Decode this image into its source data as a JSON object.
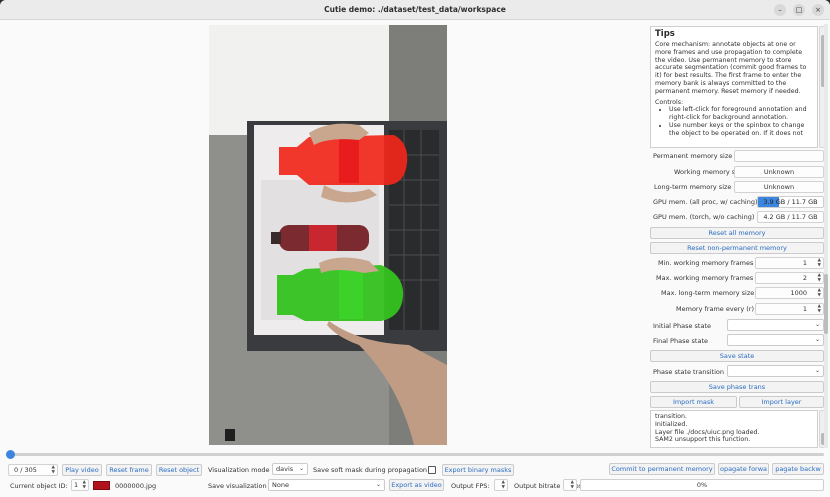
{
  "window": {
    "title": "Cutie demo: ./dataset/test_data/workspace",
    "minimize": "–",
    "maximize": "□",
    "close": "×"
  },
  "tips": {
    "heading": "Tips",
    "paragraph": "Core mechanism: annotate objects at one or more frames and use propagation to complete the video. Use permanent memory to store accurate segmentation (commit good frames to it) for best results. The first frame to enter the memory bank is always committed to the permanent memory. Reset memory if needed.",
    "controls_label": "Controls:",
    "controls": [
      "Use left-click for foreground annotation and right-click for background annotation.",
      "Use number keys or the spinbox to change the object to be operated on. If it does not"
    ]
  },
  "memory": {
    "permanent_label": "Permanent memory size",
    "permanent_value": "",
    "working_label": "Working memory size",
    "working_value": "Unknown",
    "longterm_label": "Long-term memory size",
    "longterm_value": "Unknown",
    "gpu_all_label": "GPU mem. (all proc, w/ caching)",
    "gpu_all_value": "3.9 GB / 11.7 GB",
    "gpu_all_fraction": 0.33,
    "gpu_torch_label": "GPU mem. (torch, w/o caching)",
    "gpu_torch_value": "4.2 GB / 11.7 GB",
    "reset_all": "Reset all memory",
    "reset_nonperm": "Reset non-permanent memory",
    "min_working_label": "Min. working memory frames",
    "min_working_value": "1",
    "max_working_label": "Max. working memory frames",
    "max_working_value": "2",
    "max_longterm_label": "Max. long-term memory size",
    "max_longterm_value": "1000",
    "mem_every_label": "Memory frame every (r)",
    "mem_every_value": "1"
  },
  "phase": {
    "initial_label": "Initial Phase state",
    "initial_value": "",
    "final_label": "Final Phase state",
    "final_value": "",
    "save_state": "Save state",
    "transition_label": "Phase state transition",
    "transition_value": "",
    "save_trans": "Save phase trans",
    "import_mask": "Import mask",
    "import_layer": "Import layer"
  },
  "log": [
    "transition.",
    "Initialized.",
    "Layer file ./docs/uiuc.png loaded.",
    "SAM2 unsupport this function."
  ],
  "bottom": {
    "frame_counter": "0 / 305",
    "play_video": "Play video",
    "reset_frame": "Reset frame",
    "reset_object": "Reset object",
    "vis_mode_label": "Visualization mode",
    "vis_mode_value": "davis",
    "save_soft_mask_label": "Save soft mask during propagation",
    "export_binary": "Export binary masks",
    "commit_perm": "Commit to permanent memory",
    "propagate_fwd": "opagate forwa",
    "propagate_bwd": "pagate backw",
    "current_object_label": "Current object ID:",
    "current_object_value": "1",
    "object_color": "#b1121b",
    "frame_name": "0000000.jpg",
    "save_vis_label": "Save visualization",
    "save_vis_value": "None",
    "export_video": "Export as video",
    "output_fps_label": "Output FPS:",
    "output_bitrate_label": "Output bitrate (Mbps):",
    "progress": "0%",
    "progress_value": 0
  }
}
